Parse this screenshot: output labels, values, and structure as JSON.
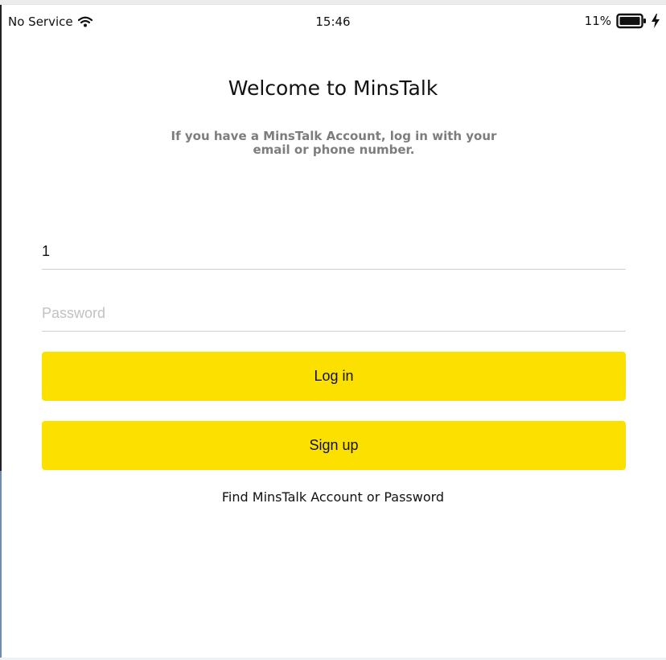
{
  "status_bar": {
    "carrier": "No Service",
    "time": "15:46",
    "battery_percent": "11%",
    "battery_level": 0.11,
    "icons": [
      "wifi-icon",
      "battery-icon",
      "charging-bolt-icon"
    ]
  },
  "login": {
    "title": "Welcome to MinsTalk",
    "subtitle": "If you have a MinsTalk Account, log in with your email or phone number.",
    "email_value": "1",
    "password_placeholder": "Password",
    "login_label": "Log in",
    "signup_label": "Sign up",
    "find_account_label": "Find MinsTalk Account or Password"
  },
  "colors": {
    "button_yellow": "#fce000",
    "subtitle_gray": "#7d7d7d",
    "placeholder_gray": "#c2c2c2"
  }
}
